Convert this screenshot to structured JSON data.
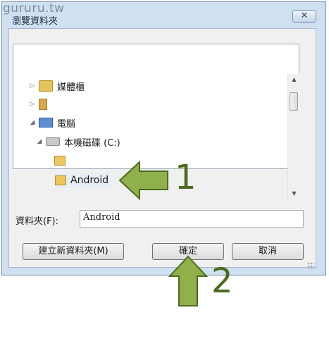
{
  "watermark": "gururu.tw",
  "dialog": {
    "title": "瀏覽資料夾",
    "close_glyph": "✕"
  },
  "tree": {
    "items": [
      {
        "label": "媒體櫃",
        "expander": "▷",
        "icon": "library-icon"
      },
      {
        "label": "",
        "expander": "▷",
        "icon": "user-folder-icon"
      },
      {
        "label": "電腦",
        "expander": "◢",
        "icon": "computer-icon"
      },
      {
        "label": "本機磁碟 (C:)",
        "expander": "◢",
        "icon": "local-disk-icon"
      },
      {
        "label": "",
        "expander": "",
        "icon": "folder-icon"
      },
      {
        "label": "Android",
        "expander": "",
        "icon": "folder-icon"
      }
    ],
    "scroll_up_glyph": "▲",
    "scroll_down_glyph": "▼"
  },
  "folder_field": {
    "label": "資料夾(F):",
    "value": "Android"
  },
  "buttons": {
    "new_folder": "建立新資料夾(M)",
    "ok": "確定",
    "cancel": "取消"
  },
  "annotations": {
    "step1": "1",
    "step2": "2",
    "arrow_color": "#8fb04a"
  }
}
